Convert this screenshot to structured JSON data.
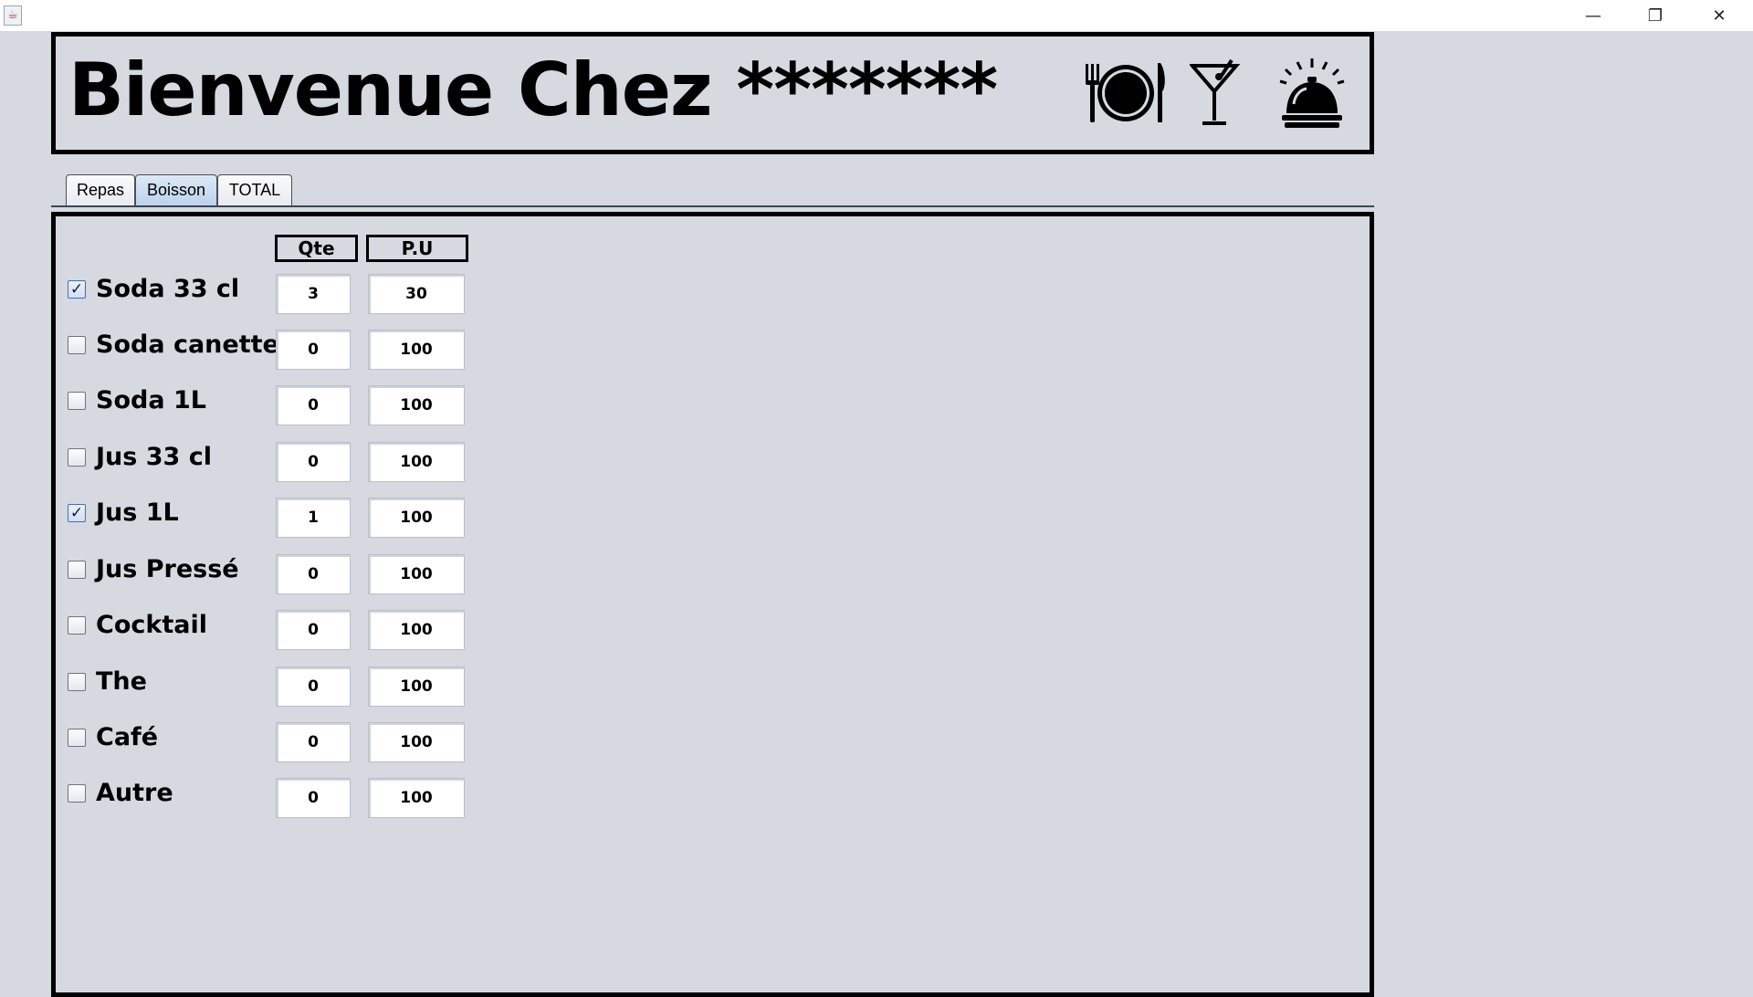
{
  "window": {
    "minimize_glyph": "—",
    "restore_glyph": "❐",
    "close_glyph": "✕"
  },
  "header": {
    "title": "Bienvenue Chez *******",
    "icons": [
      "plate-cutlery-icon",
      "cocktail-glass-icon",
      "service-bell-icon"
    ]
  },
  "tabs": [
    {
      "label": "Repas",
      "active": false
    },
    {
      "label": "Boisson",
      "active": true
    },
    {
      "label": "TOTAL",
      "active": false
    }
  ],
  "columns": {
    "qty": "Qte",
    "unit_price": "P.U"
  },
  "items": [
    {
      "label": "Soda 33 cl",
      "checked": true,
      "qty": "3",
      "price": "30"
    },
    {
      "label": "Soda canette",
      "checked": false,
      "qty": "0",
      "price": "100"
    },
    {
      "label": "Soda 1L",
      "checked": false,
      "qty": "0",
      "price": "100"
    },
    {
      "label": "Jus 33 cl",
      "checked": false,
      "qty": "0",
      "price": "100"
    },
    {
      "label": "Jus 1L",
      "checked": true,
      "qty": "1",
      "price": "100"
    },
    {
      "label": "Jus Pressé",
      "checked": false,
      "qty": "0",
      "price": "100"
    },
    {
      "label": "Cocktail",
      "checked": false,
      "qty": "0",
      "price": "100"
    },
    {
      "label": "The",
      "checked": false,
      "qty": "0",
      "price": "100"
    },
    {
      "label": "Café",
      "checked": false,
      "qty": "0",
      "price": "100"
    },
    {
      "label": "Autre",
      "checked": false,
      "qty": "0",
      "price": "100"
    }
  ],
  "colors": {
    "background": "#d6d9e0",
    "border": "#000000",
    "active_tab": "#bcd3ec"
  }
}
